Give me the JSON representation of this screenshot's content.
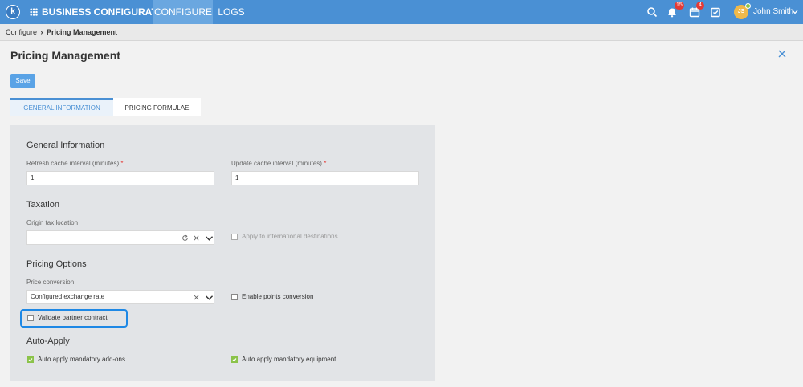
{
  "header": {
    "logo": "k",
    "app_title": "BUSINESS CONFIGURATOR",
    "nav": {
      "configure": "CONFIGURE",
      "logs": "LOGS"
    },
    "notifications_count": "15",
    "tasks_count": "4",
    "user": {
      "initials": "JS",
      "name": "John Smith"
    }
  },
  "breadcrumb": {
    "root": "Configure",
    "separator": "›",
    "current": "Pricing Management"
  },
  "page": {
    "title": "Pricing Management",
    "save_label": "Save"
  },
  "tabs": [
    {
      "label": "GENERAL INFORMATION",
      "active": true
    },
    {
      "label": "PRICING FORMULAE",
      "active": false
    }
  ],
  "general": {
    "title": "General Information",
    "refresh_label": "Refresh cache interval (minutes)",
    "refresh_value": "1",
    "update_label": "Update cache interval (minutes)",
    "update_value": "1",
    "required_mark": "*"
  },
  "taxation": {
    "title": "Taxation",
    "origin_label": "Origin tax location",
    "origin_value": "",
    "apply_intl_label": "Apply to international destinations",
    "apply_intl_checked": false
  },
  "pricing_options": {
    "title": "Pricing Options",
    "price_conversion_label": "Price conversion",
    "price_conversion_value": "Configured exchange rate",
    "enable_points_label": "Enable points conversion",
    "enable_points_checked": false,
    "validate_partner_label": "Validate partner contract",
    "validate_partner_checked": false
  },
  "auto_apply": {
    "title": "Auto-Apply",
    "addons_label": "Auto apply mandatory add-ons",
    "addons_checked": true,
    "equipment_label": "Auto apply mandatory equipment",
    "equipment_checked": true
  },
  "colors": {
    "topbar": "#4a90d4",
    "accent": "#4a90d4",
    "highlight": "#1e88e5",
    "checked": "#8bc34a",
    "badge": "#e53935"
  }
}
